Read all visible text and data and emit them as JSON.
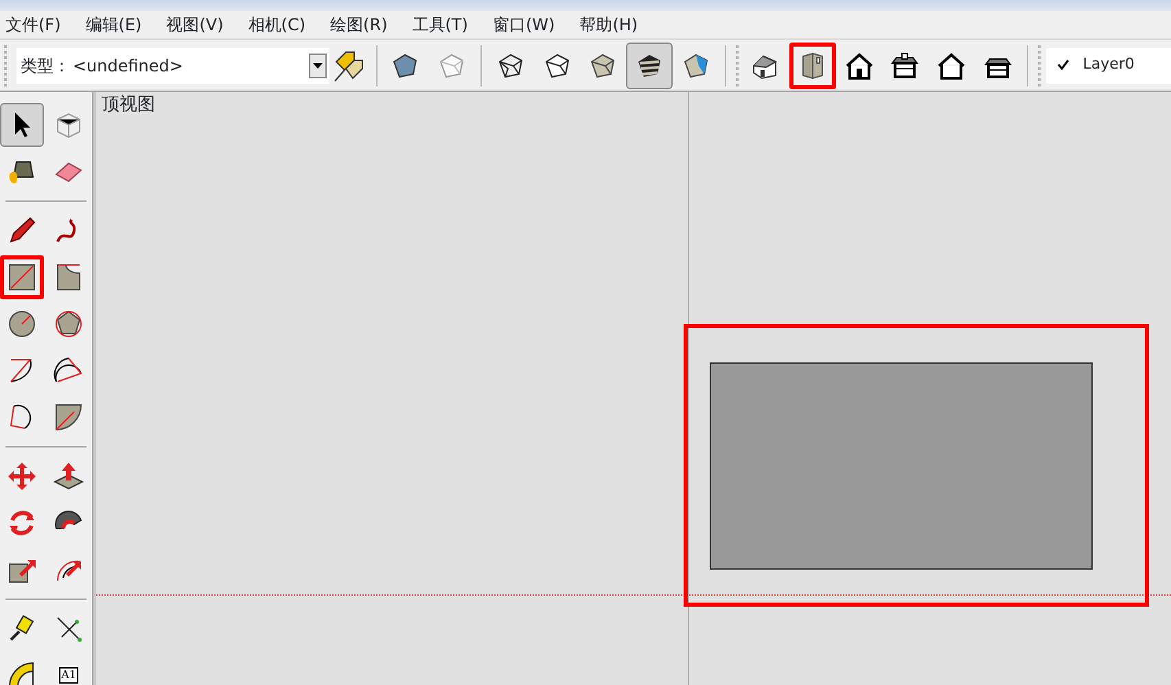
{
  "menu": [
    {
      "label": "文件(F)"
    },
    {
      "label": "编辑(E)"
    },
    {
      "label": "视图(V)"
    },
    {
      "label": "相机(C)"
    },
    {
      "label": "绘图(R)"
    },
    {
      "label": "工具(T)"
    },
    {
      "label": "窗口(W)"
    },
    {
      "label": "帮助(H)"
    }
  ],
  "toolbar": {
    "type_label": "类型：",
    "type_value": "<undefined>",
    "face_style_buttons": [
      {
        "selected": false
      },
      {
        "selected": false
      }
    ],
    "edge_style_buttons": [
      {
        "selected": false
      },
      {
        "selected": false
      },
      {
        "selected": false
      },
      {
        "selected": true
      },
      {
        "selected": false
      }
    ],
    "view_buttons": [
      {
        "highlighted": false
      },
      {
        "highlighted": true
      },
      {
        "highlighted": false
      },
      {
        "highlighted": false
      },
      {
        "highlighted": false
      },
      {
        "highlighted": false
      }
    ],
    "layer": {
      "name": "Layer0",
      "checked": true
    }
  },
  "tool_palette": [
    [
      {
        "selected": true,
        "highlighted": false
      },
      {
        "selected": false,
        "highlighted": false
      },
      {
        "selected": false,
        "highlighted": false
      },
      {
        "selected": false,
        "highlighted": false
      }
    ],
    [
      {
        "selected": false,
        "highlighted": false
      },
      {
        "selected": false,
        "highlighted": false
      },
      {
        "selected": false,
        "highlighted": true
      },
      {
        "selected": false,
        "highlighted": false
      },
      {
        "selected": false,
        "highlighted": false
      },
      {
        "selected": false,
        "highlighted": false
      },
      {
        "selected": false,
        "highlighted": false
      },
      {
        "selected": false,
        "highlighted": false
      },
      {
        "selected": false,
        "highlighted": false
      },
      {
        "selected": false,
        "highlighted": false
      }
    ],
    [
      {
        "selected": false,
        "highlighted": false
      },
      {
        "selected": false,
        "highlighted": false
      },
      {
        "selected": false,
        "highlighted": false
      },
      {
        "selected": false,
        "highlighted": false
      },
      {
        "selected": false,
        "highlighted": false
      },
      {
        "selected": false,
        "highlighted": false
      }
    ],
    [
      {
        "selected": false,
        "highlighted": false
      },
      {
        "selected": false,
        "highlighted": false
      },
      {
        "selected": false,
        "highlighted": false
      },
      {
        "selected": false,
        "highlighted": false,
        "text": "A1"
      }
    ]
  ],
  "viewport": {
    "label": "顶视图",
    "shape_highlighted": true
  }
}
